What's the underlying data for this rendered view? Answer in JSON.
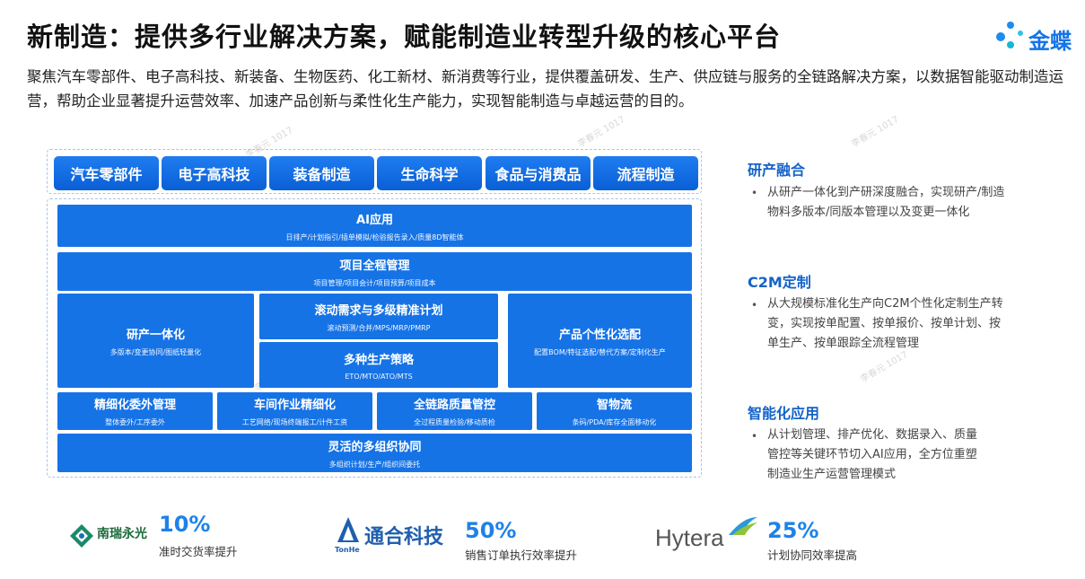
{
  "header": {
    "title": "新制造：提供多行业解决方案，赋能制造业转型升级的核心平台",
    "logo_text": "金蝶"
  },
  "description": "聚焦汽车零部件、电子高科技、新装备、生物医药、化工新材、新消费等行业，提供覆盖研发、生产、供应链与服务的全链路解决方案，以数据智能驱动制造运营，帮助企业显著提升运营效率、加速产品创新与柔性化生产能力，实现智能制造与卓越运营的目的。",
  "industries": [
    "汽车零部件",
    "电子高科技",
    "装备制造",
    "生命科学",
    "食品与消费品",
    "流程制造"
  ],
  "modules": {
    "ai": {
      "title": "AI应用",
      "sub": "日排产/计划指引/插单模拟/检验报告录入/质量8D智能体"
    },
    "project": {
      "title": "项目全程管理",
      "sub": "项目管理/项目会计/项目预算/项目成本"
    },
    "rd": {
      "title": "研产一体化",
      "sub": "多版本/变更协同/图纸轻量化"
    },
    "rolling": {
      "title": "滚动需求与多级精准计划",
      "sub": "滚动预测/合并/MPS/MRP/PMRP"
    },
    "strategy": {
      "title": "多种生产策略",
      "sub": "ETO/MTO/ATO/MTS"
    },
    "config": {
      "title": "产品个性化选配",
      "sub": "配置BOM/特征选配/替代方案/定制化生产"
    },
    "outsource": {
      "title": "精细化委外管理",
      "sub": "整体委外/工序委外"
    },
    "workshop": {
      "title": "车间作业精细化",
      "sub": "工艺网络/现场终端报工/计件工资"
    },
    "quality": {
      "title": "全链路质量管控",
      "sub": "全过程质量检验/移动质检"
    },
    "logistics": {
      "title": "智物流",
      "sub": "条码/PDA/库存全面移动化"
    },
    "multiorg": {
      "title": "灵活的多组织协同",
      "sub": "多组织计划/生产/组织间委托"
    }
  },
  "features": [
    {
      "title": "研产融合",
      "lines": [
        "从研产一体化到产研深度融合，实现研产/制造",
        "物料多版本/同版本管理以及变更一体化"
      ]
    },
    {
      "title": "C2M定制",
      "lines": [
        "从大规模标准化生产向C2M个性化定制生产转",
        "变，实现按单配置、按单报价、按单计划、按",
        "单生产、按单跟踪全流程管理"
      ]
    },
    {
      "title": "智能化应用",
      "lines": [
        "从计划管理、排产优化、数据录入、质量",
        "管控等关键环节切入AI应用，全方位重塑",
        "制造业生产运营管理模式"
      ]
    }
  ],
  "feature_bullet": "•",
  "stats": [
    {
      "logo": "南瑞永光",
      "value": "10%",
      "label": "准时交货率提升"
    },
    {
      "logo": "通合科技",
      "logo_sub": "TonHe",
      "value": "50%",
      "label": "销售订单执行效率提升"
    },
    {
      "logo": "Hytera",
      "value": "25%",
      "label": "计划协同效率提高"
    }
  ],
  "watermark": "李春元 1017",
  "colors": {
    "primary": "#1673e6",
    "accent": "#1d82e8",
    "feature_title": "#1463c8"
  }
}
